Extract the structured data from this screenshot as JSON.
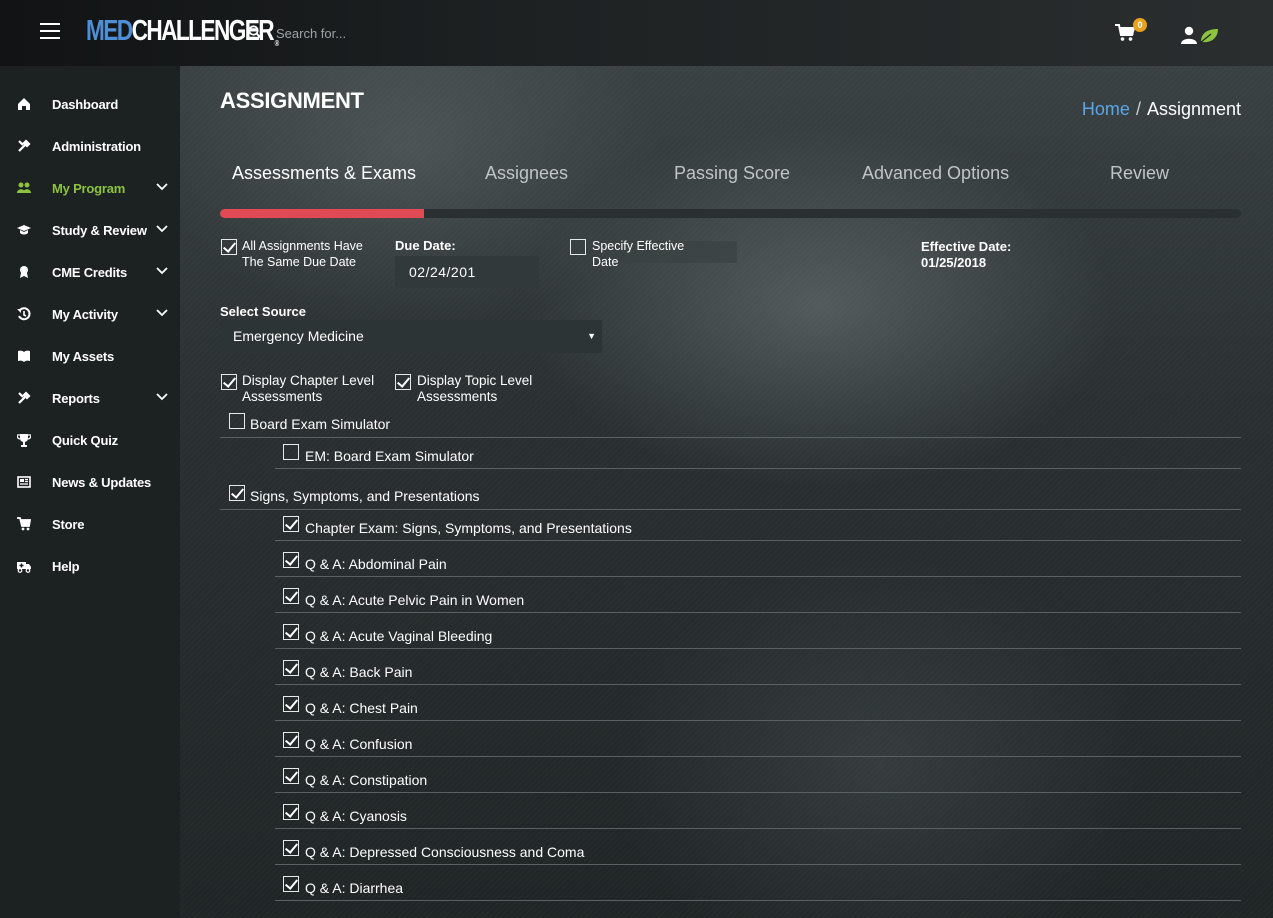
{
  "header": {
    "logo": {
      "med": "MED",
      "challenger": "CHALLENGER",
      "reg": "®"
    },
    "search_placeholder": "Search for...",
    "cart_count": "0"
  },
  "sidebar": {
    "items": [
      {
        "label": "Dashboard",
        "icon": "home-icon",
        "active": false,
        "expandable": false
      },
      {
        "label": "Administration",
        "icon": "tools-icon",
        "active": false,
        "expandable": false
      },
      {
        "label": "My Program",
        "icon": "users-icon",
        "active": true,
        "expandable": true
      },
      {
        "label": "Study & Review",
        "icon": "graduation-cap-icon",
        "active": false,
        "expandable": true
      },
      {
        "label": "CME Credits",
        "icon": "award-icon",
        "active": false,
        "expandable": true
      },
      {
        "label": "My Activity",
        "icon": "history-icon",
        "active": false,
        "expandable": true
      },
      {
        "label": "My Assets",
        "icon": "book-icon",
        "active": false,
        "expandable": false
      },
      {
        "label": "Reports",
        "icon": "tools-icon",
        "active": false,
        "expandable": true
      },
      {
        "label": "Quick Quiz",
        "icon": "trophy-icon",
        "active": false,
        "expandable": false
      },
      {
        "label": "News & Updates",
        "icon": "newspaper-icon",
        "active": false,
        "expandable": false
      },
      {
        "label": "Store",
        "icon": "cart-icon",
        "active": false,
        "expandable": false
      },
      {
        "label": "Help",
        "icon": "ambulance-icon",
        "active": false,
        "expandable": false
      }
    ]
  },
  "main": {
    "title": "ASSIGNMENT",
    "breadcrumb": {
      "home": "Home",
      "separator": "/",
      "current": "Assignment"
    },
    "tabs": [
      "Assessments & Exams",
      "Assignees",
      "Passing Score",
      "Advanced Options",
      "Review"
    ],
    "progress_fraction": 0.2,
    "options": {
      "same_due_date_label": "All Assignments Have The Same Due Date",
      "same_due_date_checked": true,
      "due_date_label": "Due Date:",
      "due_date_value": "02/24/201",
      "specify_effective_label": "Specify Effective Date",
      "specify_effective_checked": false,
      "effective_date_label": "Effective Date:",
      "effective_date_value": "01/25/2018"
    },
    "source": {
      "label": "Select Source",
      "selected": "Emergency Medicine"
    },
    "display": {
      "chapter_label": "Display Chapter Level Assessments",
      "chapter_checked": true,
      "topic_label": "Display Topic Level Assessments",
      "topic_checked": true
    },
    "groups": [
      {
        "label": "Board Exam Simulator",
        "checked": false,
        "items": [
          {
            "label": "EM: Board Exam Simulator",
            "checked": false
          }
        ]
      },
      {
        "label": "Signs, Symptoms, and Presentations",
        "checked": true,
        "items": [
          {
            "label": "Chapter Exam: Signs, Symptoms, and Presentations",
            "checked": true
          },
          {
            "label": "Q & A: Abdominal Pain",
            "checked": true
          },
          {
            "label": "Q & A: Acute Pelvic Pain in Women",
            "checked": true
          },
          {
            "label": "Q & A: Acute Vaginal Bleeding",
            "checked": true
          },
          {
            "label": "Q & A: Back Pain",
            "checked": true
          },
          {
            "label": "Q & A: Chest Pain",
            "checked": true
          },
          {
            "label": "Q & A: Confusion",
            "checked": true
          },
          {
            "label": "Q & A: Constipation",
            "checked": true
          },
          {
            "label": "Q & A: Cyanosis",
            "checked": true
          },
          {
            "label": "Q & A: Depressed Consciousness and Coma",
            "checked": true
          },
          {
            "label": "Q & A: Diarrhea",
            "checked": true
          }
        ]
      }
    ]
  },
  "colors": {
    "accent_active_nav": "#8dc33f",
    "progress_fill": "#e14a55",
    "breadcrumb_link": "#5aa6e6",
    "cart_badge": "#e8a11b",
    "logo_med": "#4f8fd6"
  }
}
